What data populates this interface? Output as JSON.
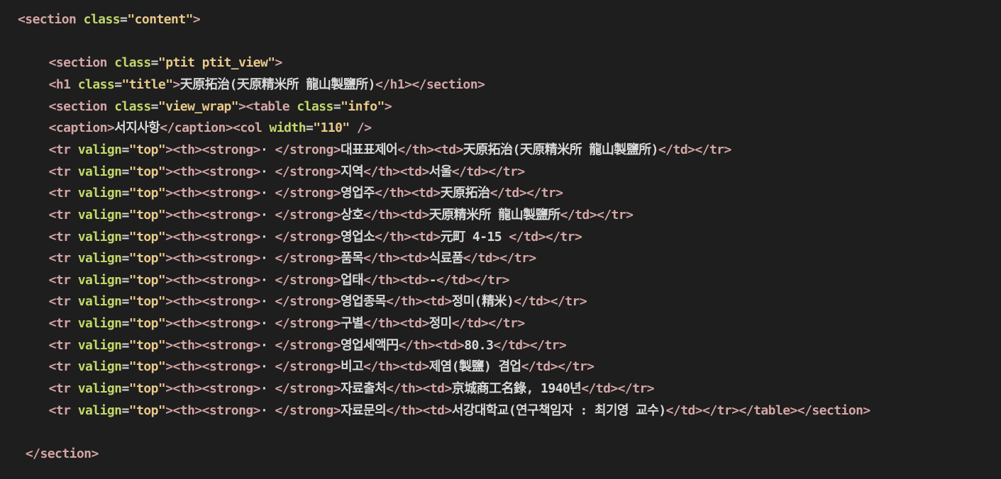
{
  "code": {
    "lines": [
      {
        "indent": 0,
        "tokens": [
          [
            "tag",
            "<section "
          ],
          [
            "attr",
            "class"
          ],
          [
            "eq",
            "="
          ],
          [
            "str",
            "\"content\""
          ],
          [
            "tag",
            ">"
          ]
        ]
      },
      {
        "indent": 0,
        "tokens": []
      },
      {
        "indent": 4,
        "tokens": [
          [
            "tag",
            "<section "
          ],
          [
            "attr",
            "class"
          ],
          [
            "eq",
            "="
          ],
          [
            "str",
            "\"ptit ptit_view\""
          ],
          [
            "tag",
            ">"
          ]
        ]
      },
      {
        "indent": 4,
        "tokens": [
          [
            "tag",
            "<h1 "
          ],
          [
            "attr",
            "class"
          ],
          [
            "eq",
            "="
          ],
          [
            "str",
            "\"title\""
          ],
          [
            "tag",
            ">"
          ],
          [
            "txt",
            "天原拓治(天原精米所 龍山製鹽所)"
          ],
          [
            "tag",
            "</h1></section>"
          ]
        ]
      },
      {
        "indent": 4,
        "tokens": [
          [
            "tag",
            "<section "
          ],
          [
            "attr",
            "class"
          ],
          [
            "eq",
            "="
          ],
          [
            "str",
            "\"view_wrap\""
          ],
          [
            "tag",
            "><table "
          ],
          [
            "attr",
            "class"
          ],
          [
            "eq",
            "="
          ],
          [
            "str",
            "\"info\""
          ],
          [
            "tag",
            ">"
          ]
        ]
      },
      {
        "indent": 4,
        "tokens": [
          [
            "tag",
            "<caption>"
          ],
          [
            "txt",
            "서지사항"
          ],
          [
            "tag",
            "</caption><col "
          ],
          [
            "attr",
            "width"
          ],
          [
            "eq",
            "="
          ],
          [
            "str",
            "\"110\""
          ],
          [
            "tag",
            " />"
          ]
        ]
      },
      {
        "indent": 4,
        "tokens": [
          [
            "tag",
            "<tr "
          ],
          [
            "attr",
            "valign"
          ],
          [
            "eq",
            "="
          ],
          [
            "str",
            "\"top\""
          ],
          [
            "tag",
            "><th><strong>"
          ],
          [
            "txt",
            "· "
          ],
          [
            "tag",
            "</strong>"
          ],
          [
            "txt",
            "대표표제어"
          ],
          [
            "tag",
            "</th><td>"
          ],
          [
            "txt",
            "天原拓治(天原精米所 龍山製鹽所)"
          ],
          [
            "tag",
            "</td></tr>"
          ]
        ]
      },
      {
        "indent": 4,
        "tokens": [
          [
            "tag",
            "<tr "
          ],
          [
            "attr",
            "valign"
          ],
          [
            "eq",
            "="
          ],
          [
            "str",
            "\"top\""
          ],
          [
            "tag",
            "><th><strong>"
          ],
          [
            "txt",
            "· "
          ],
          [
            "tag",
            "</strong>"
          ],
          [
            "txt",
            "지역"
          ],
          [
            "tag",
            "</th><td>"
          ],
          [
            "txt",
            "서울"
          ],
          [
            "tag",
            "</td></tr>"
          ]
        ]
      },
      {
        "indent": 4,
        "tokens": [
          [
            "tag",
            "<tr "
          ],
          [
            "attr",
            "valign"
          ],
          [
            "eq",
            "="
          ],
          [
            "str",
            "\"top\""
          ],
          [
            "tag",
            "><th><strong>"
          ],
          [
            "txt",
            "· "
          ],
          [
            "tag",
            "</strong>"
          ],
          [
            "txt",
            "영업주"
          ],
          [
            "tag",
            "</th><td>"
          ],
          [
            "txt",
            "天原拓治"
          ],
          [
            "tag",
            "</td></tr>"
          ]
        ]
      },
      {
        "indent": 4,
        "tokens": [
          [
            "tag",
            "<tr "
          ],
          [
            "attr",
            "valign"
          ],
          [
            "eq",
            "="
          ],
          [
            "str",
            "\"top\""
          ],
          [
            "tag",
            "><th><strong>"
          ],
          [
            "txt",
            "· "
          ],
          [
            "tag",
            "</strong>"
          ],
          [
            "txt",
            "상호"
          ],
          [
            "tag",
            "</th><td>"
          ],
          [
            "txt",
            "天原精米所 龍山製鹽所"
          ],
          [
            "tag",
            "</td></tr>"
          ]
        ]
      },
      {
        "indent": 4,
        "tokens": [
          [
            "tag",
            "<tr "
          ],
          [
            "attr",
            "valign"
          ],
          [
            "eq",
            "="
          ],
          [
            "str",
            "\"top\""
          ],
          [
            "tag",
            "><th><strong>"
          ],
          [
            "txt",
            "· "
          ],
          [
            "tag",
            "</strong>"
          ],
          [
            "txt",
            "영업소"
          ],
          [
            "tag",
            "</th><td>"
          ],
          [
            "txt",
            "元町 4-15 "
          ],
          [
            "tag",
            "</td></tr>"
          ]
        ]
      },
      {
        "indent": 4,
        "tokens": [
          [
            "tag",
            "<tr "
          ],
          [
            "attr",
            "valign"
          ],
          [
            "eq",
            "="
          ],
          [
            "str",
            "\"top\""
          ],
          [
            "tag",
            "><th><strong>"
          ],
          [
            "txt",
            "· "
          ],
          [
            "tag",
            "</strong>"
          ],
          [
            "txt",
            "품목"
          ],
          [
            "tag",
            "</th><td>"
          ],
          [
            "txt",
            "식료품"
          ],
          [
            "tag",
            "</td></tr>"
          ]
        ]
      },
      {
        "indent": 4,
        "tokens": [
          [
            "tag",
            "<tr "
          ],
          [
            "attr",
            "valign"
          ],
          [
            "eq",
            "="
          ],
          [
            "str",
            "\"top\""
          ],
          [
            "tag",
            "><th><strong>"
          ],
          [
            "txt",
            "· "
          ],
          [
            "tag",
            "</strong>"
          ],
          [
            "txt",
            "업태"
          ],
          [
            "tag",
            "</th><td>"
          ],
          [
            "txt",
            "-"
          ],
          [
            "tag",
            "</td></tr>"
          ]
        ]
      },
      {
        "indent": 4,
        "tokens": [
          [
            "tag",
            "<tr "
          ],
          [
            "attr",
            "valign"
          ],
          [
            "eq",
            "="
          ],
          [
            "str",
            "\"top\""
          ],
          [
            "tag",
            "><th><strong>"
          ],
          [
            "txt",
            "· "
          ],
          [
            "tag",
            "</strong>"
          ],
          [
            "txt",
            "영업종목"
          ],
          [
            "tag",
            "</th><td>"
          ],
          [
            "txt",
            "정미(精米)"
          ],
          [
            "tag",
            "</td></tr>"
          ]
        ]
      },
      {
        "indent": 4,
        "tokens": [
          [
            "tag",
            "<tr "
          ],
          [
            "attr",
            "valign"
          ],
          [
            "eq",
            "="
          ],
          [
            "str",
            "\"top\""
          ],
          [
            "tag",
            "><th><strong>"
          ],
          [
            "txt",
            "· "
          ],
          [
            "tag",
            "</strong>"
          ],
          [
            "txt",
            "구별"
          ],
          [
            "tag",
            "</th><td>"
          ],
          [
            "txt",
            "정미"
          ],
          [
            "tag",
            "</td></tr>"
          ]
        ]
      },
      {
        "indent": 4,
        "tokens": [
          [
            "tag",
            "<tr "
          ],
          [
            "attr",
            "valign"
          ],
          [
            "eq",
            "="
          ],
          [
            "str",
            "\"top\""
          ],
          [
            "tag",
            "><th><strong>"
          ],
          [
            "txt",
            "· "
          ],
          [
            "tag",
            "</strong>"
          ],
          [
            "txt",
            "영업세액円"
          ],
          [
            "tag",
            "</th><td>"
          ],
          [
            "txt",
            "80.3"
          ],
          [
            "tag",
            "</td></tr>"
          ]
        ]
      },
      {
        "indent": 4,
        "tokens": [
          [
            "tag",
            "<tr "
          ],
          [
            "attr",
            "valign"
          ],
          [
            "eq",
            "="
          ],
          [
            "str",
            "\"top\""
          ],
          [
            "tag",
            "><th><strong>"
          ],
          [
            "txt",
            "· "
          ],
          [
            "tag",
            "</strong>"
          ],
          [
            "txt",
            "비고"
          ],
          [
            "tag",
            "</th><td>"
          ],
          [
            "txt",
            "제염(製鹽) 겸업"
          ],
          [
            "tag",
            "</td></tr>"
          ]
        ]
      },
      {
        "indent": 4,
        "tokens": [
          [
            "tag",
            "<tr "
          ],
          [
            "attr",
            "valign"
          ],
          [
            "eq",
            "="
          ],
          [
            "str",
            "\"top\""
          ],
          [
            "tag",
            "><th><strong>"
          ],
          [
            "txt",
            "· "
          ],
          [
            "tag",
            "</strong>"
          ],
          [
            "txt",
            "자료출처"
          ],
          [
            "tag",
            "</th><td>"
          ],
          [
            "txt",
            "京城商工名錄, 1940년"
          ],
          [
            "tag",
            "</td></tr>"
          ]
        ]
      },
      {
        "indent": 4,
        "tokens": [
          [
            "tag",
            "<tr "
          ],
          [
            "attr",
            "valign"
          ],
          [
            "eq",
            "="
          ],
          [
            "str",
            "\"top\""
          ],
          [
            "tag",
            "><th><strong>"
          ],
          [
            "txt",
            "· "
          ],
          [
            "tag",
            "</strong>"
          ],
          [
            "txt",
            "자료문의"
          ],
          [
            "tag",
            "</th><td>"
          ],
          [
            "txt",
            "서강대학교(연구책임자 : 최기영 교수)"
          ],
          [
            "tag",
            "</td></tr></table></section>"
          ]
        ]
      },
      {
        "indent": 0,
        "tokens": []
      },
      {
        "indent": 1,
        "tokens": [
          [
            "tag",
            "</section>"
          ]
        ]
      }
    ]
  }
}
